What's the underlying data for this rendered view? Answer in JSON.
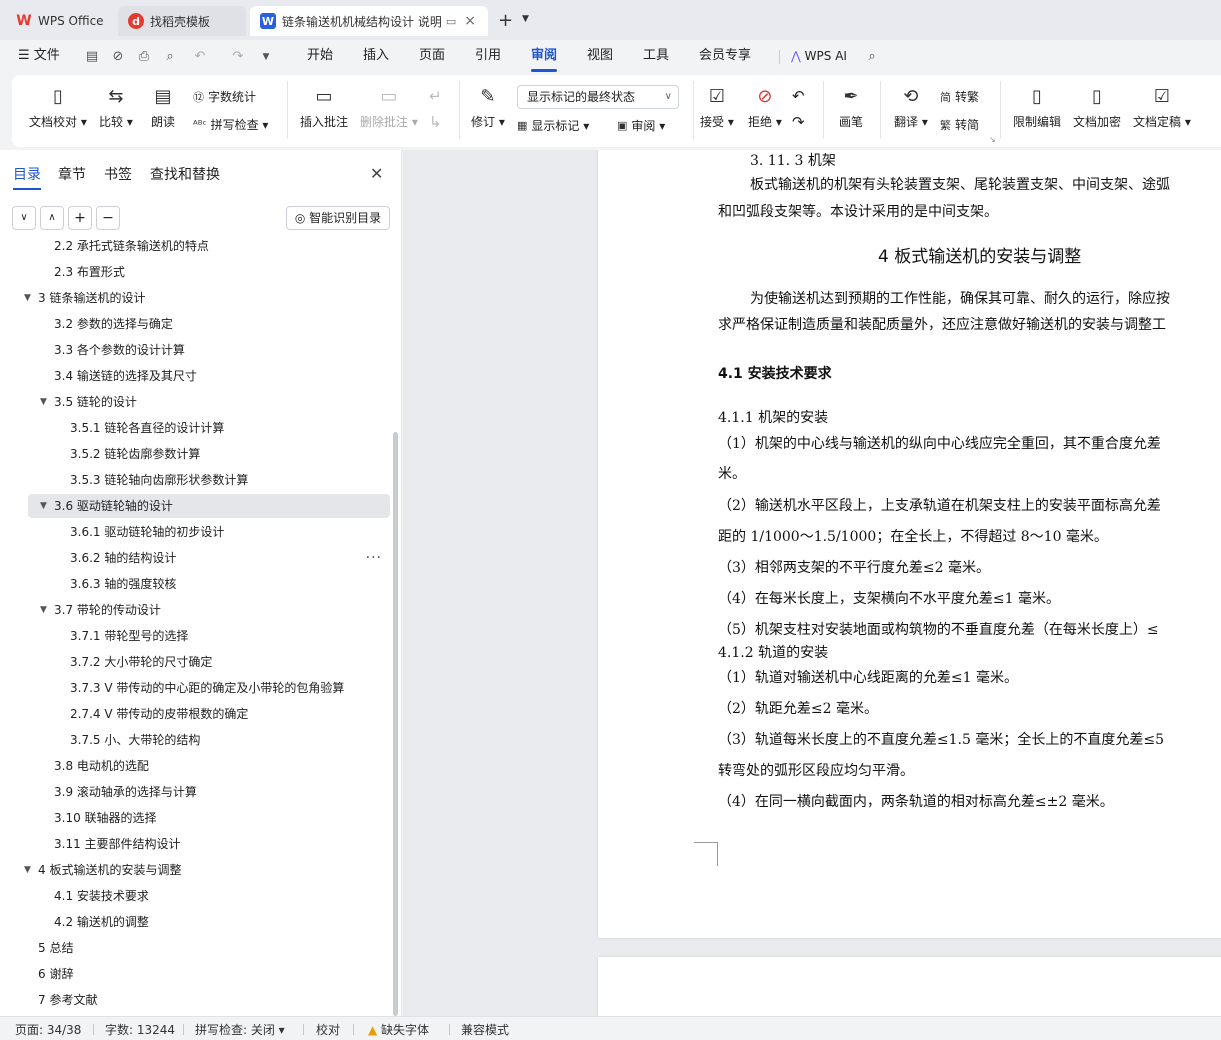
{
  "tabs": [
    {
      "label": "WPS Office",
      "icon": "wps-logo-icon"
    },
    {
      "label": "找稻壳模板",
      "icon": "docer-icon"
    },
    {
      "label": "链条输送机机械结构设计 说明",
      "icon": "writer-icon"
    }
  ],
  "menu": {
    "file": "文件",
    "items": [
      "开始",
      "插入",
      "页面",
      "引用",
      "审阅",
      "视图",
      "工具",
      "会员专享"
    ],
    "active": "审阅",
    "ai": "WPS AI"
  },
  "ribbon": {
    "doc_proof": "文档校对",
    "compare": "比较",
    "read_aloud": "朗读",
    "word_count": "字数统计",
    "spell_check": "拼写检查",
    "insert_comment": "插入批注",
    "delete_comment": "删除批注",
    "track_changes": "修订",
    "markup_state": "显示标记的最终状态",
    "show_markup": "显示标记",
    "review_pane": "审阅",
    "accept": "接受",
    "reject": "拒绝",
    "pen": "画笔",
    "translate": "翻译",
    "to_traditional": "转繁",
    "to_simplified": "转简",
    "restrict_edit": "限制编辑",
    "encrypt": "文档加密",
    "finalize": "文档定稿"
  },
  "sidebar": {
    "tabs": [
      "目录",
      "章节",
      "书签",
      "查找和替换"
    ],
    "active_tab": "目录",
    "smart_toc": "智能识别目录",
    "toc": [
      {
        "text": "2.2 承托式链条输送机的特点",
        "level": 2,
        "toggle": ""
      },
      {
        "text": "2.3 布置形式",
        "level": 2,
        "toggle": ""
      },
      {
        "text": "3   链条输送机的设计",
        "level": 1,
        "toggle": "▼"
      },
      {
        "text": "3.2  参数的选择与确定",
        "level": 2,
        "toggle": ""
      },
      {
        "text": "3.3  各个参数的设计计算",
        "level": 2,
        "toggle": ""
      },
      {
        "text": "3.4    输送链的选择及其尺寸",
        "level": 2,
        "toggle": ""
      },
      {
        "text": "3.5  链轮的设计",
        "level": 2,
        "toggle": "▼"
      },
      {
        "text": "3.5.1  链轮各直径的设计计算",
        "level": 3,
        "toggle": ""
      },
      {
        "text": "3.5.2  链轮齿廓参数计算",
        "level": 3,
        "toggle": ""
      },
      {
        "text": "3.5.3  链轮轴向齿廓形状参数计算",
        "level": 3,
        "toggle": ""
      },
      {
        "text": "3.6    驱动链轮轴的设计",
        "level": 2,
        "toggle": "▼",
        "selected": true
      },
      {
        "text": "3.6.1  驱动链轮轴的初步设计",
        "level": 3,
        "toggle": ""
      },
      {
        "text": "3.6.2 轴的结构设计",
        "level": 3,
        "toggle": "",
        "more": "···"
      },
      {
        "text": "3.6.3 轴的强度较核",
        "level": 3,
        "toggle": ""
      },
      {
        "text": "3.7 带轮的传动设计",
        "level": 2,
        "toggle": "▼"
      },
      {
        "text": "3.7.1 带轮型号的选择",
        "level": 3,
        "toggle": ""
      },
      {
        "text": "3.7.2 大小带轮的尺寸确定",
        "level": 3,
        "toggle": ""
      },
      {
        "text": "3.7.3 V 带传动的中心距的确定及小带轮的包角验算",
        "level": 3,
        "toggle": ""
      },
      {
        "text": "2.7.4 V 带传动的皮带根数的确定",
        "level": 3,
        "toggle": ""
      },
      {
        "text": "3.7.5 小、大带轮的结构",
        "level": 3,
        "toggle": ""
      },
      {
        "text": "3.8 电动机的选配",
        "level": 2,
        "toggle": ""
      },
      {
        "text": "3.9  滚动轴承的选择与计算",
        "level": 2,
        "toggle": ""
      },
      {
        "text": "3.10 联轴器的选择",
        "level": 2,
        "toggle": ""
      },
      {
        "text": "3.11 主要部件结构设计",
        "level": 2,
        "toggle": ""
      },
      {
        "text": "4    板式输送机的安装与调整",
        "level": 1,
        "toggle": "▼"
      },
      {
        "text": "4.1 安装技术要求",
        "level": 2,
        "toggle": ""
      },
      {
        "text": "4.2 输送机的调整",
        "level": 2,
        "toggle": ""
      },
      {
        "text": "5  总结",
        "level": 1,
        "toggle": ""
      },
      {
        "text": "6  谢辞",
        "level": 1,
        "toggle": ""
      },
      {
        "text": "7  参考文献",
        "level": 1,
        "toggle": ""
      }
    ]
  },
  "document": {
    "lines": [
      {
        "text": "3. 11. 3 机架",
        "style": "body",
        "indent": 1
      },
      {
        "text": "板式输送机的机架有头轮装置支架、尾轮装置支架、中间支架、途弧",
        "style": "body",
        "indent": 2
      },
      {
        "text": "和凹弧段支架等。本设计采用的是中间支架。",
        "style": "body",
        "indent": 0
      },
      {
        "text": "4    板式输送机的安装与调整",
        "style": "h1",
        "indent": 0
      },
      {
        "text": "为使输送机达到预期的工作性能，确保其可靠、耐久的运行，除应按",
        "style": "body",
        "indent": 2
      },
      {
        "text": "求严格保证制造质量和装配质量外，还应注意做好输送机的安装与调整工",
        "style": "body",
        "indent": 0
      },
      {
        "text": "4.1 安装技术要求",
        "style": "h2",
        "indent": 0
      },
      {
        "text": "4.1.1 机架的安装",
        "style": "body",
        "indent": 0
      },
      {
        "text": "（1）机架的中心线与输送机的纵向中心线应完全重回，其不重合度允差",
        "style": "body",
        "indent": 0
      },
      {
        "text": "米。",
        "style": "body",
        "indent": 0
      },
      {
        "text": "（2）输送机水平区段上，上支承轨道在机架支柱上的安装平面标高允差",
        "style": "body",
        "indent": 0
      },
      {
        "text": "距的 1/1000～1.5/1000；在全长上，不得超过 8～10 毫米。",
        "style": "body",
        "indent": 0
      },
      {
        "text": "（3）相邻两支架的不平行度允差≤2 毫米。",
        "style": "body",
        "indent": 0
      },
      {
        "text": "（4）在每米长度上，支架横向不水平度允差≤1 毫米。",
        "style": "body",
        "indent": 0
      },
      {
        "text": "（5）机架支柱对安装地面或构筑物的不垂直度允差（在每米长度上）≤",
        "style": "body",
        "indent": 0
      },
      {
        "text": "4.1.2 轨道的安装",
        "style": "body",
        "indent": 0
      },
      {
        "text": "（1）轨道对输送机中心线距离的允差≤1 毫米。",
        "style": "body",
        "indent": 0
      },
      {
        "text": "（2）轨距允差≤2 毫米。",
        "style": "body",
        "indent": 0
      },
      {
        "text": "（3）轨道每米长度上的不直度允差≤1.5 毫米；全长上的不直度允差≤5",
        "style": "body",
        "indent": 0
      },
      {
        "text": "转弯处的弧形区段应均匀平滑。",
        "style": "body",
        "indent": 0
      },
      {
        "text": "（4）在同一横向截面内，两条轨道的相对标高允差≤±2 毫米。",
        "style": "body",
        "indent": 0
      }
    ]
  },
  "statusbar": {
    "page": "页面: 34/38",
    "words": "字数: 13244",
    "spell": "拼写检查: 关闭",
    "proof": "校对",
    "missing_font": "缺失字体",
    "compat": "兼容模式"
  },
  "colors": {
    "accent": "#1f55d0",
    "wps_red": "#e23b30",
    "writer_blue": "#2b5fe0"
  }
}
